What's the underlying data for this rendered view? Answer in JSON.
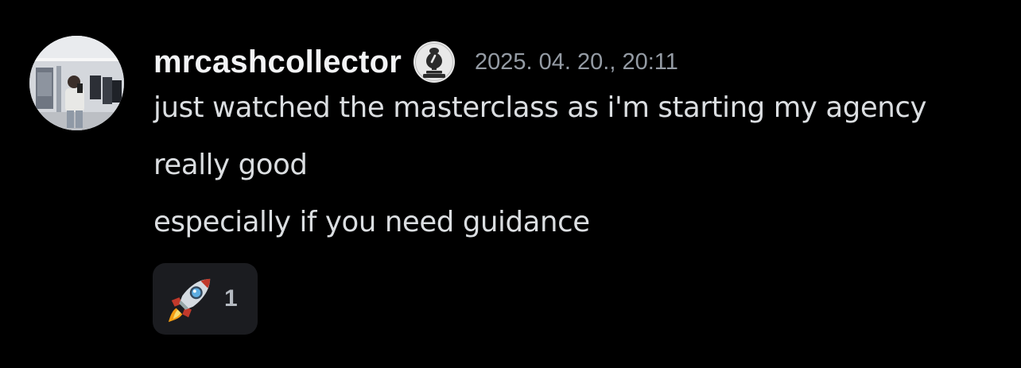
{
  "message": {
    "author": {
      "username": "mrcashcollector",
      "avatar": "profile-photo",
      "role_badge_icon": "bishop-chess-piece-icon"
    },
    "timestamp": "2025. 04. 20., 20:11",
    "lines": [
      "just watched the masterclass as i'm starting my agency",
      "really good",
      "especially if you need guidance"
    ],
    "reactions": [
      {
        "emoji": "rocket-emoji",
        "count": "1"
      }
    ]
  },
  "colors": {
    "background": "#000000",
    "username": "#f2f3f5",
    "text": "#dbdee1",
    "timestamp": "#949ba4",
    "reaction_bg": "#1b1c20",
    "reaction_count": "#b5bac1"
  }
}
